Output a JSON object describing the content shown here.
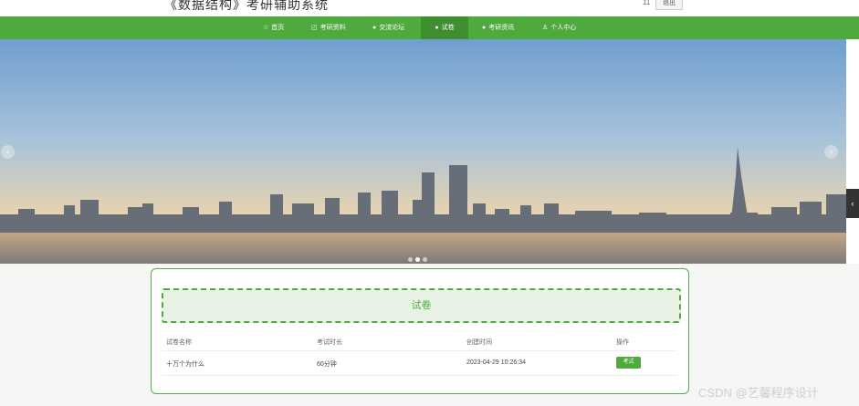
{
  "header": {
    "title": "《数据结构》考研辅助系统",
    "user_id": "11",
    "logout_label": "退出"
  },
  "nav": {
    "items": [
      {
        "label": "首页",
        "icon": "star-icon"
      },
      {
        "label": "考研资料",
        "icon": "bag-icon"
      },
      {
        "label": "交流论坛",
        "icon": "info-icon"
      },
      {
        "label": "试卷",
        "icon": "info-icon"
      },
      {
        "label": "考研资讯",
        "icon": "info-icon"
      },
      {
        "label": "个人中心",
        "icon": "user-icon"
      }
    ],
    "active_index": 3
  },
  "carousel": {
    "prev_glyph": "‹",
    "next_glyph": "›",
    "slide_count": 3,
    "active_slide": 1
  },
  "side_tab": {
    "glyph": "‹"
  },
  "exam_panel": {
    "title": "试卷",
    "columns": [
      "试卷名称",
      "考试时长",
      "创建时间",
      "操作"
    ],
    "rows": [
      {
        "name": "十万个为什么",
        "duration": "60分钟",
        "created": "2023-04-29 10:26:34",
        "action": "考试"
      }
    ]
  },
  "watermark": "CSDN @艺馨程序设计",
  "colors": {
    "primary": "#4eaa3d",
    "nav_active": "#3f8f30"
  }
}
